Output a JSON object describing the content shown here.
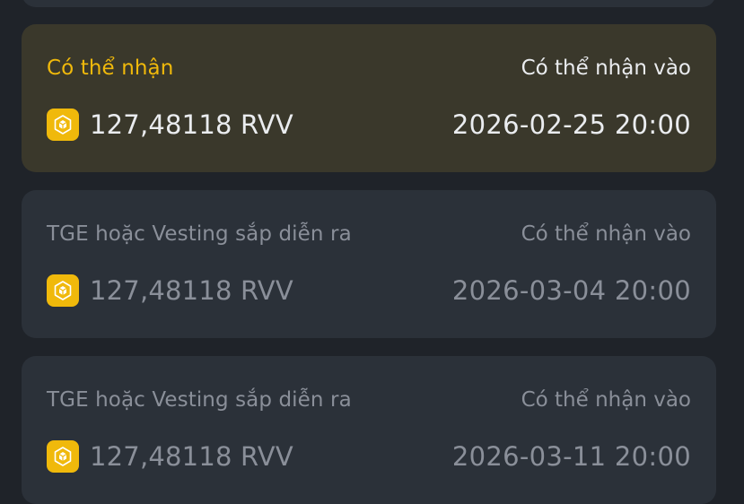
{
  "cards": [
    {
      "status": "Có thể nhận",
      "claim_label": "Có thể nhận vào",
      "amount": "127,48118 RVV",
      "date": "2026-02-25 20:00",
      "icon": "bnb-token-icon"
    },
    {
      "status": "TGE hoặc Vesting sắp diễn ra",
      "claim_label": "Có thể nhận vào",
      "amount": "127,48118 RVV",
      "date": "2026-03-04 20:00",
      "icon": "bnb-token-icon"
    },
    {
      "status": "TGE hoặc Vesting sắp diễn ra",
      "claim_label": "Có thể nhận vào",
      "amount": "127,48118 RVV",
      "date": "2026-03-11 20:00",
      "icon": "bnb-token-icon"
    }
  ],
  "colors": {
    "background": "#1f2329",
    "card": "#2b3139",
    "active_card": "#3a382b",
    "accent": "#f0b90b",
    "muted_text": "#8a8f99",
    "bright_text": "#eaecef"
  }
}
